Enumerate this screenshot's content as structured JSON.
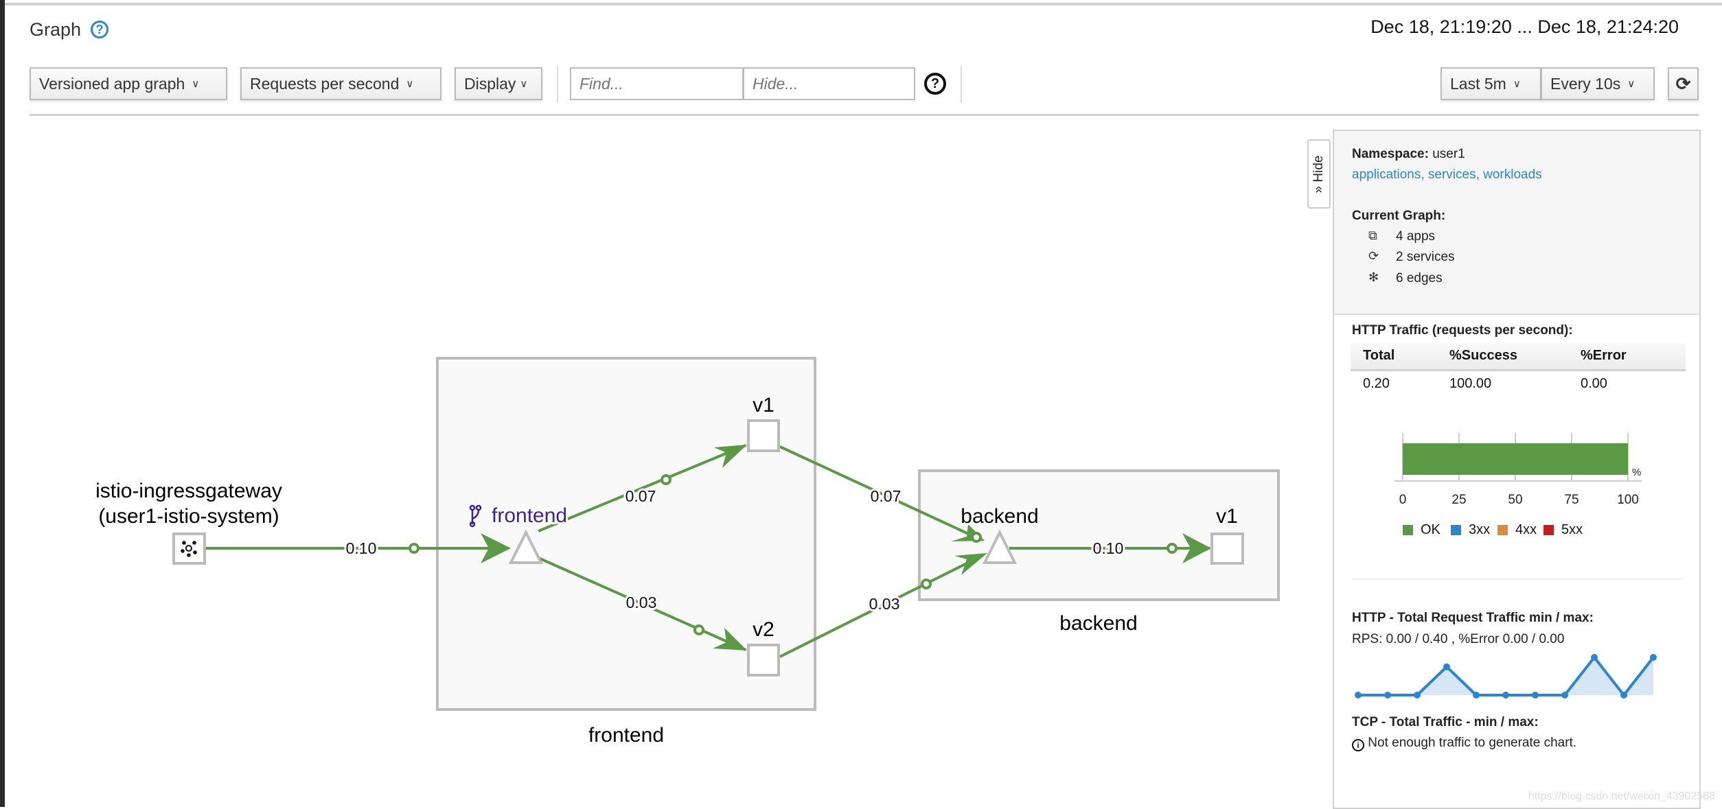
{
  "header": {
    "title": "Graph",
    "date_range": "Dec 18, 21:19:20 ... Dec 18, 21:24:20"
  },
  "toolbar": {
    "graph_type": "Versioned app graph",
    "edge_labels": "Requests per second",
    "display": "Display",
    "find_placeholder": "Find...",
    "hide_placeholder": "Hide...",
    "duration": "Last 5m",
    "refresh_interval": "Every 10s"
  },
  "graph": {
    "nodes": {
      "gateway_line1": "istio-ingressgateway",
      "gateway_line2": "(user1-istio-system)",
      "frontend_service": "frontend",
      "frontend_v1": "v1",
      "frontend_v2": "v2",
      "frontend_box": "frontend",
      "backend_service": "backend",
      "backend_v1": "v1",
      "backend_box": "backend"
    },
    "edges": {
      "gateway_to_frontend": "0.10",
      "frontend_to_v1": "0.07",
      "frontend_to_v2": "0.03",
      "v1_to_backend": "0.07",
      "v2_to_backend": "0.03",
      "backend_to_v1": "0.10"
    },
    "edge_color": "#5a9a44"
  },
  "side_panel": {
    "hide_label": "» Hide",
    "namespace_label": "Namespace:",
    "namespace": "user1",
    "links": "applications, services, workloads",
    "current_graph_label": "Current Graph:",
    "apps": "4 apps",
    "services": "2 services",
    "edges": "6 edges",
    "http_traffic_title": "HTTP Traffic (requests per second):",
    "table": {
      "headers": [
        "Total",
        "%Success",
        "%Error"
      ],
      "values": [
        "0.20",
        "100.00",
        "0.00"
      ]
    },
    "bar_chart": {
      "type": "bar",
      "categories": [
        "OK",
        "3xx",
        "4xx",
        "5xx"
      ],
      "values": [
        100,
        0,
        0,
        0
      ],
      "colors": [
        "#5a9a44",
        "#2b85d0",
        "#e0893a",
        "#c1201f"
      ],
      "ticks": [
        "0",
        "25",
        "50",
        "75",
        "100"
      ],
      "unit": "%",
      "xlim": [
        0,
        100
      ]
    },
    "http_total_title": "HTTP - Total Request Traffic min / max:",
    "http_total_values": "RPS: 0.00 / 0.40 , %Error 0.00 / 0.00",
    "sparkline": {
      "type": "area",
      "values": [
        0,
        0,
        0,
        0.3,
        0,
        0,
        0,
        0,
        0.4,
        0,
        0.4
      ],
      "color": "#2b85d0"
    },
    "tcp_title": "TCP - Total Traffic - min / max:",
    "tcp_message": "Not enough traffic to generate chart."
  },
  "watermark": "https://blog.csdn.net/weixin_43902588"
}
